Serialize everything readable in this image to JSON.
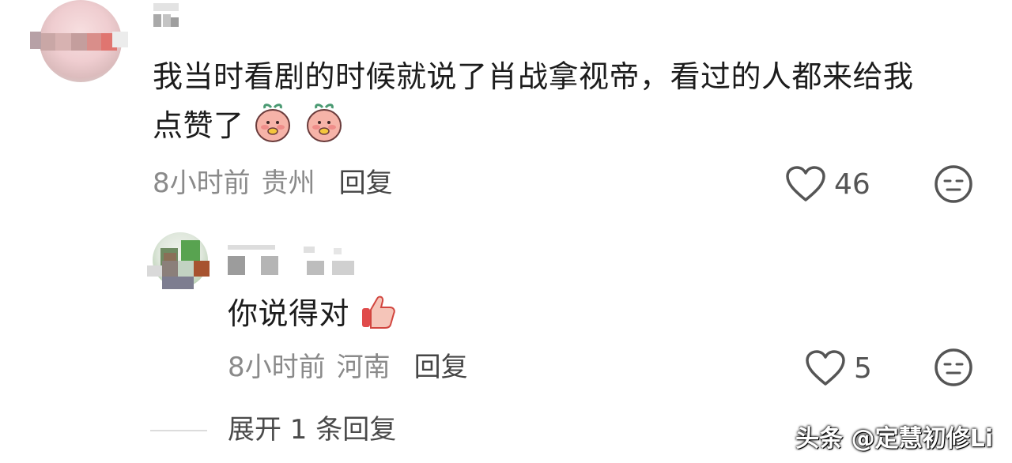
{
  "comment": {
    "text_line1": "我当时看剧的时候就说了肖战拿视帝，看过的人都来给我",
    "text_line2": "点赞了",
    "emoji": "peach-face-emoji",
    "time": "8小时前",
    "location": "贵州",
    "reply_label": "回复",
    "like_count": "46"
  },
  "reply": {
    "text": "你说得对",
    "emoji": "thumbs-up-emoji",
    "time": "8小时前",
    "location": "河南",
    "reply_label": "回复",
    "like_count": "5"
  },
  "expand_replies_label": "展开 1 条回复",
  "watermark": "头条 @定慧初修Li",
  "colors": {
    "text_primary": "#1c1c1c",
    "text_meta": "#8a8a8a",
    "icon": "#555555"
  }
}
